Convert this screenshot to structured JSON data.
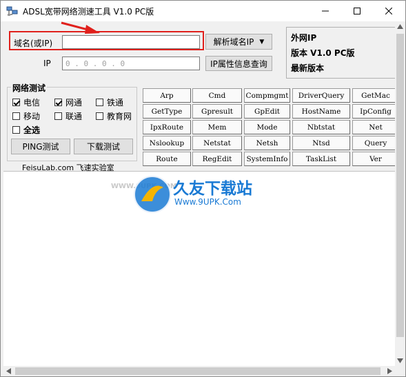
{
  "window": {
    "title": "ADSL宽带网络测速工具 V1.0 PC版",
    "controls": [
      "minimize-icon",
      "maximize-icon",
      "close-icon"
    ]
  },
  "domain": {
    "label": "域名(或IP)",
    "value": "",
    "resolve_button": "解析域名IP"
  },
  "ip": {
    "label": "IP",
    "placeholder": "0 . 0 . 0 . 0",
    "info_button": "IP属性信息查询"
  },
  "info_panel": {
    "external_ip": "外网IP",
    "version": "版本 V1.0 PC版",
    "latest": "最新版本"
  },
  "network_test": {
    "title": "网络测试",
    "options": [
      {
        "label": "电信",
        "checked": true
      },
      {
        "label": "网通",
        "checked": true
      },
      {
        "label": "铁通",
        "checked": false
      },
      {
        "label": "移动",
        "checked": false
      },
      {
        "label": "联通",
        "checked": false
      },
      {
        "label": "教育网",
        "checked": false
      }
    ],
    "select_all": {
      "label": "全选",
      "checked": false
    },
    "ping_button": "PING测试",
    "download_button": "下载测试",
    "footer": "FeisuLab.com 飞速实验室"
  },
  "commands": [
    [
      "Arp",
      "Cmd",
      "Compmgmt",
      "DriverQuery",
      "GetMac"
    ],
    [
      "GetType",
      "Gpresult",
      "GpEdit",
      "HostName",
      "IpConfig"
    ],
    [
      "IpxRoute",
      "Mem",
      "Mode",
      "Nbtstat",
      "Net"
    ],
    [
      "Nslookup",
      "Netstat",
      "Netsh",
      "Ntsd",
      "Query"
    ],
    [
      "Route",
      "RegEdit",
      "SystemInfo",
      "TaskList",
      "Ver"
    ]
  ],
  "watermark": {
    "brand": "久友下载站",
    "url_left": "WWW.9UPK.COM",
    "url": "Www.9UPK.Com"
  },
  "colors": {
    "annotation_red": "#e0201c",
    "watermark_blue": "#1a7ad4"
  }
}
